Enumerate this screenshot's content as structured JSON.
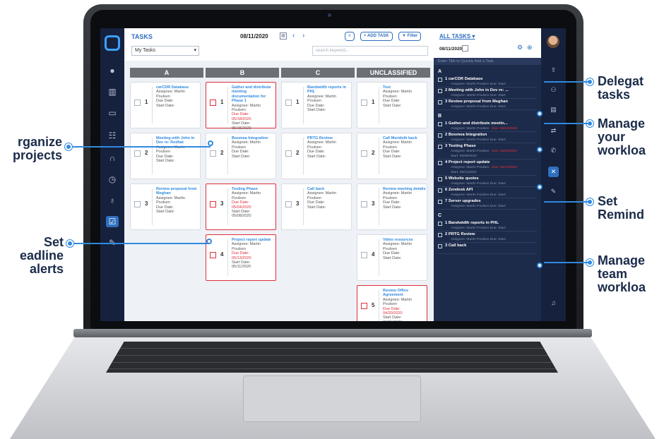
{
  "app": {
    "title": "TASKS",
    "my_tasks": "My Tasks",
    "date": "08/11/2020",
    "add_task": "+ ADD TASK",
    "filter": "Filter",
    "search_placeholder": "search keyword...",
    "menu_icon": "list-icon"
  },
  "columns": [
    {
      "head": "A",
      "cards": [
        {
          "n": "1",
          "title": "carCDR Database",
          "lines": [
            "Assignee: Martin",
            "Poulsen",
            "Due Date:",
            "Start Date:"
          ],
          "red": false
        },
        {
          "n": "2",
          "title": "Meeting with John in Dev re: Redhat",
          "lines": [
            "Assignee: Martin",
            "Poulsen",
            "Due Date:",
            "Start Date:"
          ],
          "red": false
        },
        {
          "n": "3",
          "title": "Review proposal from Meghan",
          "lines": [
            "Assignee: Martin",
            "Poulsen",
            "Due Date:",
            "Start Date:"
          ],
          "red": false
        }
      ]
    },
    {
      "head": "B",
      "cards": [
        {
          "n": "1",
          "title": "Gather and distribute meeting documentation for Phase 1",
          "lines": [
            "Assignee: Martin",
            "Poulsen",
            "Due Date:",
            "05/18/2020",
            "Start Date:",
            "05/15/2020"
          ],
          "red": true
        },
        {
          "n": "2",
          "title": "Boomea Integration",
          "lines": [
            "Assignee: Martin",
            "Poulsen",
            "Due Date:",
            "Start Date:"
          ],
          "red": false
        },
        {
          "n": "3",
          "title": "Testing Phase",
          "lines": [
            "Assignee: Martin",
            "Poulsen",
            "Due Date:",
            "05/04/2020",
            "Start Date:",
            "05/08/2020"
          ],
          "red": true
        },
        {
          "n": "4",
          "title": "Project report update",
          "lines": [
            "Assignee: Martin",
            "Poulsen",
            "Due Date:",
            "05/13/2020",
            "Start Date:",
            "05/11/2020"
          ],
          "red": true
        }
      ]
    },
    {
      "head": "C",
      "cards": [
        {
          "n": "1",
          "title": "Bandwidth reports in PHL",
          "lines": [
            "Assignee: Martin",
            "Poulsen",
            "Due Date:",
            "Start Date:"
          ],
          "red": false
        },
        {
          "n": "2",
          "title": "PRTG Review",
          "lines": [
            "Assignee: Martin",
            "Poulsen",
            "Due Date:",
            "Start Date:"
          ],
          "red": false
        },
        {
          "n": "3",
          "title": "Call back",
          "lines": [
            "Assignee: Martin",
            "Poulsen",
            "Due Date:",
            "Start Date:"
          ],
          "red": false
        }
      ]
    },
    {
      "head": "UNCLASSIFIED",
      "cards": [
        {
          "n": "1",
          "title": "Test",
          "lines": [
            "Assignee: Martin",
            "Poulsen",
            "Due Date:",
            "Start Date:"
          ],
          "red": false
        },
        {
          "n": "2",
          "title": "Call Merideth back",
          "lines": [
            "Assignee: Martin",
            "Poulsen",
            "Due Date:",
            "Start Date:"
          ],
          "red": false
        },
        {
          "n": "3",
          "title": "Review meeting details",
          "lines": [
            "Assignee: Martin",
            "Poulsen",
            "Due Date:",
            "Start Date:"
          ],
          "red": false
        },
        {
          "n": "4",
          "title": "Video resources",
          "lines": [
            "Assignee: Martin",
            "Poulsen",
            "Due Date:",
            "Start Date:"
          ],
          "red": false
        },
        {
          "n": "5",
          "title": "Review Office Agreement",
          "lines": [
            "Assignee: Martin",
            "Poulsen",
            "Due Date:",
            "04/30/2020",
            "Start Date:",
            "03/26/2020"
          ],
          "red": true
        }
      ]
    }
  ],
  "panel": {
    "title": "ALL TASKS",
    "date": "08/11/2020",
    "quick_add": "Enter Title to Quickly Add a Task",
    "groups": [
      {
        "name": "A",
        "tasks": [
          {
            "name": "1  carCDR Database",
            "meta": "Assignee: Martin Poulsen   Due:   Start:"
          },
          {
            "name": "2  Meeting with John in Dev re: ...",
            "meta": "Assignee: Martin Poulsen   Due:   Start:"
          },
          {
            "name": "3  Review proposal from Meghan",
            "meta": "Assignee: Martin Poulsen   Due:   Start:"
          }
        ]
      },
      {
        "name": "B",
        "tasks": [
          {
            "name": "1  Gather and distribute meetin...",
            "meta": "Assignee: Martin Poulsen",
            "due": "Due: 05/18/2020"
          },
          {
            "name": "2  Boomea Integration",
            "meta": "Assignee: Martin Poulsen   Due:   Start:"
          },
          {
            "name": "3  Testing Phase",
            "meta": "Assignee: Martin Poulsen",
            "due": "Due: 05/04/2020",
            "extra": "Start: 05/08/2020"
          },
          {
            "name": "4  Project report update",
            "meta": "Assignee: Martin Poulsen",
            "due": "Due: 05/13/2020",
            "extra": "Start: 05/11/2020"
          },
          {
            "name": "5  Website quotes",
            "meta": "Assignee: Martin Poulsen   Due:   Start:"
          },
          {
            "name": "6  Zendesk API",
            "meta": "Assignee: Martin Poulsen   Due:   Start:"
          },
          {
            "name": "7  Server upgrades",
            "meta": "Assignee: Martin Poulsen   Due:   Start:"
          }
        ]
      },
      {
        "name": "C",
        "tasks": [
          {
            "name": "1  Bandwidth reports in PHL",
            "meta": "Assignee: Martin Poulsen   Due:   Start:"
          },
          {
            "name": "2  PRTG Review",
            "meta": "Assignee: Martin Poulsen   Due:   Start:"
          },
          {
            "name": "3  Call back",
            "meta": ""
          }
        ]
      }
    ]
  },
  "callouts": {
    "organize": [
      "rganize",
      "projects"
    ],
    "deadline": [
      "Set",
      "eadline",
      "alerts"
    ],
    "delegate": [
      "Delegat",
      "tasks"
    ],
    "manage_your": [
      "Manage",
      "your",
      "workloa"
    ],
    "set_reminders": [
      "Set",
      "Remind"
    ],
    "manage_team": [
      "Manage",
      "team",
      "workloa"
    ]
  },
  "colors": {
    "accent": "#2f8ae0",
    "brand": "#2f6fbf",
    "alert": "#e0303a",
    "panel": "#1d2b4a"
  }
}
